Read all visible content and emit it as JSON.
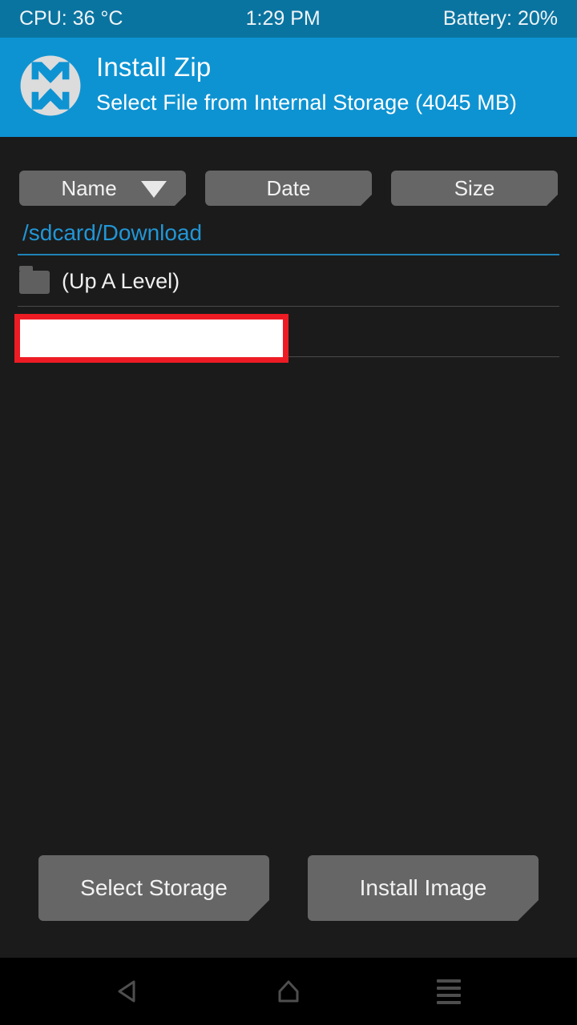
{
  "status_bar": {
    "cpu": "CPU: 36 °C",
    "time": "1:29 PM",
    "battery": "Battery: 20%"
  },
  "header": {
    "logo_name": "twrp-logo",
    "title": "Install Zip",
    "subtitle": "Select File from Internal Storage (4045 MB)"
  },
  "sort_bar": {
    "name_label": "Name",
    "date_label": "Date",
    "size_label": "Size",
    "active_sort": "Name",
    "sort_direction_icon": "caret-down-icon"
  },
  "path": {
    "current": "/sdcard/Download"
  },
  "file_list": {
    "rows": [
      {
        "icon": "folder-icon",
        "label": "(Up A Level)"
      },
      {
        "icon": "none",
        "label": ""
      }
    ]
  },
  "redaction": {
    "present": true,
    "border_color": "#ed1c24",
    "fill_color": "#ffffff"
  },
  "actions": {
    "select_storage": "Select Storage",
    "install_image": "Install Image"
  },
  "nav_bar": {
    "back_icon": "back-triangle-icon",
    "home_icon": "home-icon",
    "menu_icon": "menu-lines-icon"
  },
  "colors": {
    "status_bar_blue": "#0a74a0",
    "header_blue": "#0e93d2",
    "background": "#1b1b1b",
    "button_gray": "#666666",
    "path_blue": "#2196d6",
    "accent_red": "#ed1c24"
  }
}
